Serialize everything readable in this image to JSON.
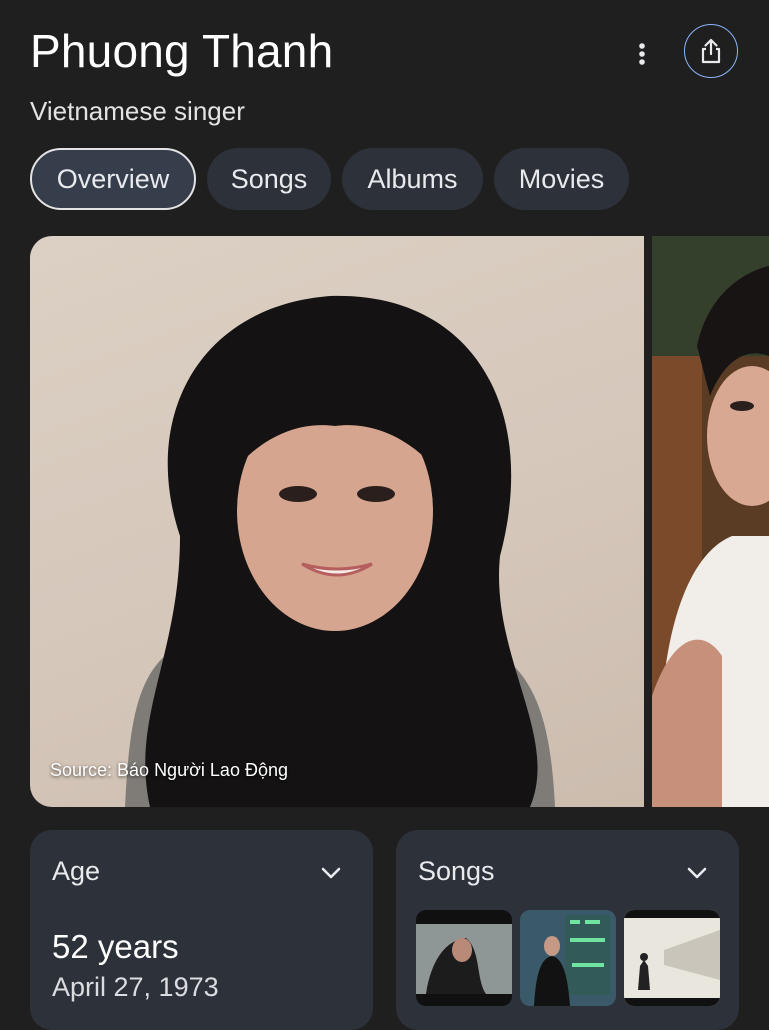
{
  "header": {
    "title": "Phuong Thanh",
    "subtitle": "Vietnamese singer",
    "more_icon": "more-vert-icon",
    "share_icon": "share-icon"
  },
  "tabs": [
    {
      "label": "Overview",
      "active": true
    },
    {
      "label": "Songs",
      "active": false
    },
    {
      "label": "Albums",
      "active": false
    },
    {
      "label": "Movies",
      "active": false
    }
  ],
  "photos": {
    "main_caption": "Source: Báo Người Lao Động"
  },
  "cards": {
    "age": {
      "label": "Age",
      "value": "52 years",
      "date": "April 27, 1973",
      "chevron_icon": "chevron-down-icon"
    },
    "songs": {
      "label": "Songs",
      "chevron_icon": "chevron-down-icon"
    }
  },
  "colors": {
    "background": "#1f1f1f",
    "chip": "#2d3139",
    "chip_active": "#363d4b",
    "share_outline": "#8ab4f8"
  }
}
